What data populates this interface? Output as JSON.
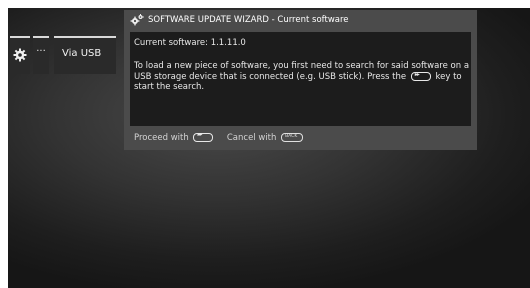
{
  "menu": {
    "gear_icon": "gear-icon",
    "dots_label": "···",
    "usb_label": "Via USB"
  },
  "dialog": {
    "title_icon": "gears-icon",
    "title": "SOFTWARE UPDATE WIZARD - Current software",
    "current_software": "Current software: 1.1.11.0",
    "info_before_key": "To load a new piece of software, you first need to search for said software on a USB storage device that is connected (e.g. USB stick). Press the",
    "info_after_key": "key to start the search.",
    "footer": {
      "proceed_label": "Proceed with",
      "cancel_label": "Cancel with"
    }
  },
  "colors": {
    "background_outer": "#ffffff",
    "screen_center": "#4a4a4a",
    "screen_edge": "#161616",
    "dialog_frame": "#4b4b4b",
    "dialog_content": "#1c1c1c",
    "text": "#e8e8e8"
  }
}
